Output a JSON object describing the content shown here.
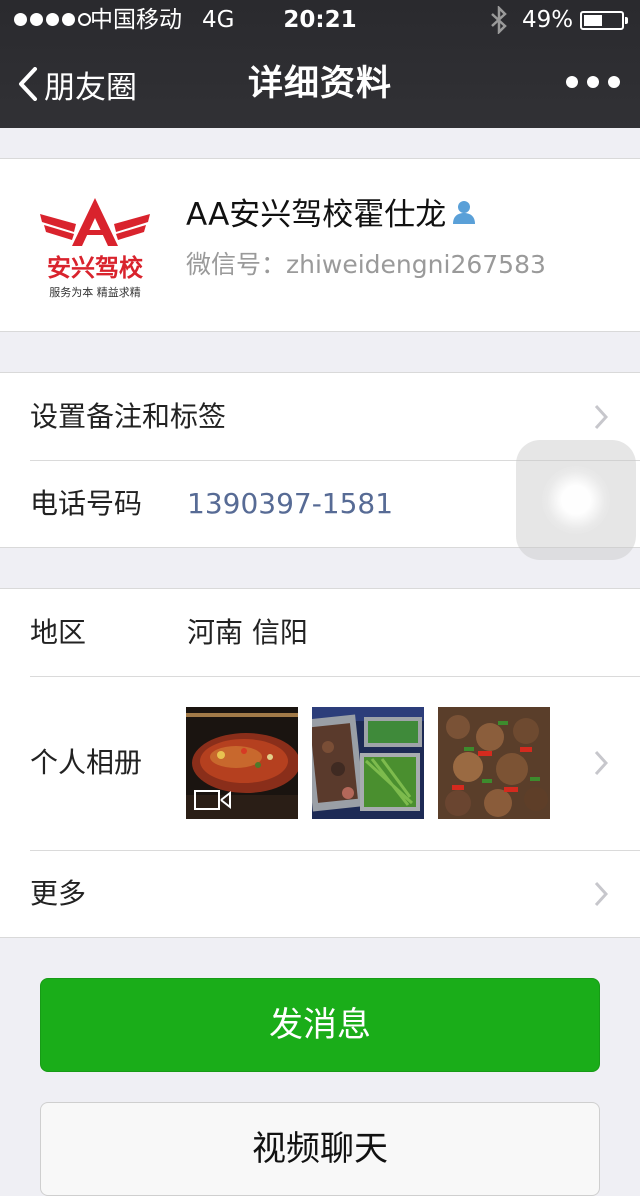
{
  "status_bar": {
    "carrier": "中国移动",
    "network": "4G",
    "time": "20:21",
    "battery_percent": "49%",
    "battery_level": 0.49,
    "signal_bars_filled": 4,
    "signal_bars_total": 5
  },
  "nav": {
    "back_label": "朋友圈",
    "title": "详细资料"
  },
  "profile": {
    "name": "AA安兴驾校霍仕龙",
    "wechat_id": "微信号：zhiweidengni267583",
    "avatar_text": "安兴驾校",
    "avatar_slogan": "服务为本 精益求精"
  },
  "details": {
    "remark_label": "设置备注和标签",
    "phone_label": "电话号码",
    "phone_value": "1390397-1581",
    "region_label": "地区",
    "region_value": "河南 信阳",
    "album_label": "个人相册",
    "more_label": "更多"
  },
  "actions": {
    "send_message": "发消息",
    "video_call": "视频聊天"
  },
  "colors": {
    "topbar": "#2e2e32",
    "accent_green": "#1aad19",
    "link_blue": "#576b95",
    "logo_red": "#d9232d"
  },
  "icons": {
    "back": "chevron-left-icon",
    "more": "more-dots-icon",
    "bluetooth": "bluetooth-icon",
    "verified": "person-icon",
    "chevron": "chevron-right-icon",
    "video": "video-camera-icon"
  }
}
